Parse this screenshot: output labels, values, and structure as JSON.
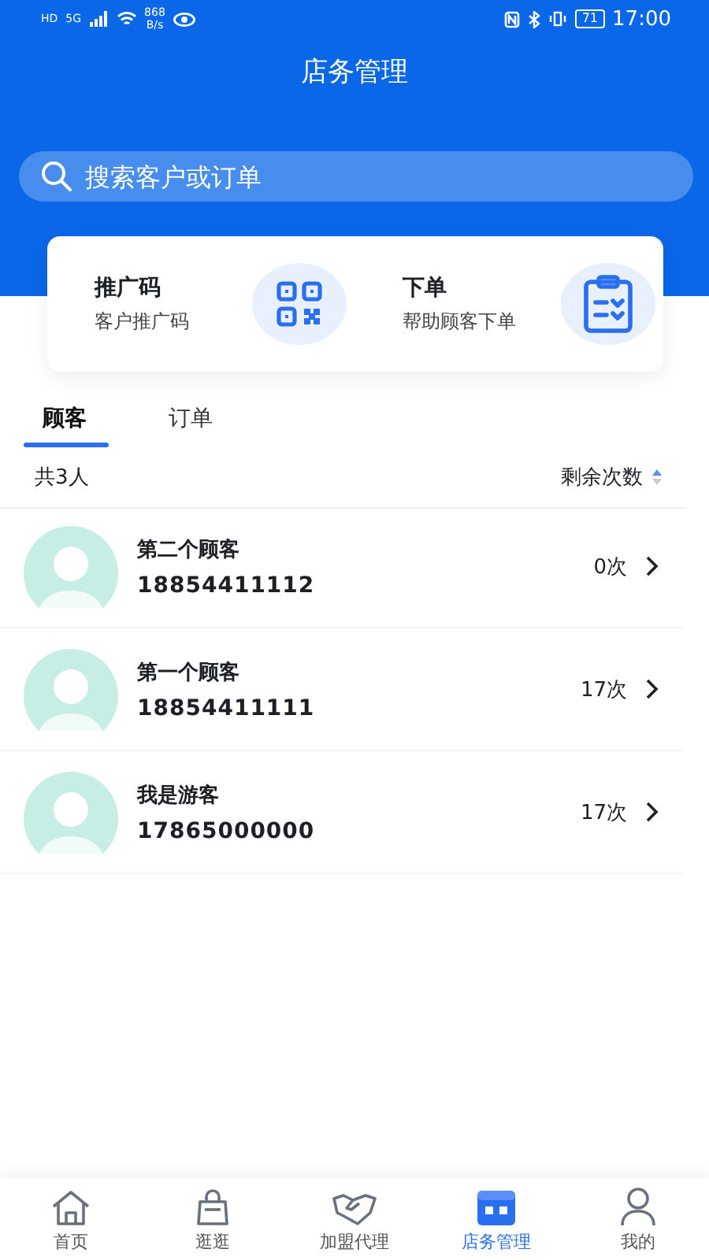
{
  "status_bar": {
    "left": [
      "HD",
      "5G"
    ],
    "speed": "868",
    "speed_unit": "B/s",
    "battery": "71",
    "time": "17:00"
  },
  "title": "店务管理",
  "search": {
    "placeholder": "搜索客户或订单"
  },
  "shortcuts": [
    {
      "kind": "qr",
      "title": "推广码",
      "subtitle": "客户推广码"
    },
    {
      "kind": "order",
      "title": "下单",
      "subtitle": "帮助顾客下单"
    }
  ],
  "tabs": [
    {
      "label": "顾客",
      "selected": true
    },
    {
      "label": "订单",
      "selected": false
    }
  ],
  "summary": {
    "count": "共3人",
    "sort_label": "剩余次数"
  },
  "customers": [
    {
      "name": "第二个顾客",
      "phone": "18854411112",
      "remaining": "0次"
    },
    {
      "name": "第一个顾客",
      "phone": "18854411111",
      "remaining": "17次"
    },
    {
      "name": "我是游客",
      "phone": "17865000000",
      "remaining": "17次"
    }
  ],
  "nav": [
    {
      "kind": "home",
      "label": "首页",
      "selected": false
    },
    {
      "kind": "bag",
      "label": "逛逛",
      "selected": false
    },
    {
      "kind": "handshake",
      "label": "加盟代理",
      "selected": false
    },
    {
      "kind": "store",
      "label": "店务管理",
      "selected": true
    },
    {
      "kind": "user",
      "label": "我的",
      "selected": false
    }
  ]
}
